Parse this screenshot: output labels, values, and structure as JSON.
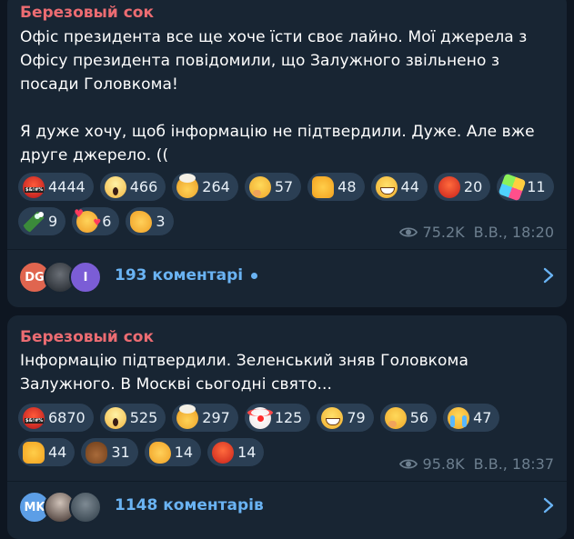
{
  "messages": [
    {
      "author": "Березовый сок",
      "text": "Офіс президента все ще хоче їсти своє лайно. Мої джерела з\nОфісу президента повідомили, що Залужного звільнено з\nпосади Головкома!\n\nЯ дуже хочу, щоб інформацію не підтвердили. Дуже. Але вже\nдруге джерело. ((",
      "reactions": [
        {
          "icon": "swearing-face-icon",
          "count": "4444"
        },
        {
          "icon": "screaming-face-icon",
          "count": "466"
        },
        {
          "icon": "exploding-head-icon",
          "count": "264"
        },
        {
          "icon": "thinking-face-icon",
          "count": "57"
        },
        {
          "icon": "thumbs-up-icon",
          "count": "48"
        },
        {
          "icon": "grinning-face-icon",
          "count": "44"
        },
        {
          "icon": "angry-face-icon",
          "count": "20"
        },
        {
          "icon": "party-popper-icon",
          "count": "11"
        },
        {
          "icon": "champagne-bottle-icon",
          "count": "9"
        },
        {
          "icon": "smiling-face-hearts-icon",
          "count": "6"
        },
        {
          "icon": "clapping-hands-icon",
          "count": "3"
        }
      ],
      "views": "75.2K",
      "author_sign": "В.В.,",
      "time": "18:20",
      "comments": {
        "avatar_initials": [
          "DG",
          "",
          "I"
        ],
        "label": "193 коментарі",
        "unread": true
      }
    },
    {
      "author": "Березовый сок",
      "text": "Інформацію підтвердили. Зеленський зняв Головкома\nЗалужного. В Москві сьогодні свято...",
      "reactions": [
        {
          "icon": "swearing-face-icon",
          "count": "6870"
        },
        {
          "icon": "screaming-face-icon",
          "count": "525"
        },
        {
          "icon": "exploding-head-icon",
          "count": "297"
        },
        {
          "icon": "clown-face-icon",
          "count": "125"
        },
        {
          "icon": "grinning-face-icon",
          "count": "79"
        },
        {
          "icon": "thinking-face-icon",
          "count": "56"
        },
        {
          "icon": "crying-face-icon",
          "count": "47"
        },
        {
          "icon": "thumbs-up-icon",
          "count": "44"
        },
        {
          "icon": "poop-icon",
          "count": "31"
        },
        {
          "icon": "clapping-hands-icon",
          "count": "14"
        },
        {
          "icon": "angry-face-icon",
          "count": "14"
        }
      ],
      "views": "95.8K",
      "author_sign": "В.В.,",
      "time": "18:37",
      "comments": {
        "avatar_initials": [
          "MK",
          "",
          ""
        ],
        "label": "1148 коментарів",
        "unread": false
      }
    }
  ],
  "colors": {
    "background": "#0e1621",
    "bubble": "#182533",
    "author": "#ec6c72",
    "link": "#6ab3f3",
    "pill": "#2b3f54",
    "meta": "#6d7f8f"
  }
}
